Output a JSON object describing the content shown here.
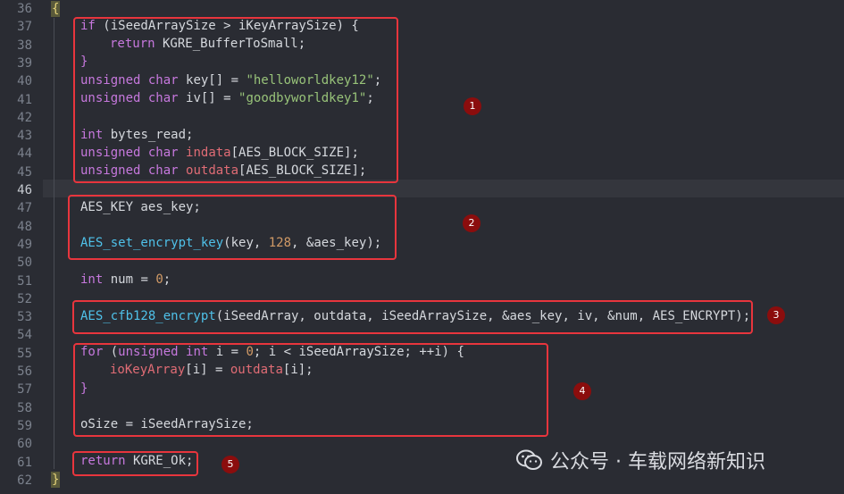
{
  "editor": {
    "line_numbers": [
      "36",
      "37",
      "38",
      "39",
      "40",
      "41",
      "42",
      "43",
      "44",
      "45",
      "46",
      "47",
      "48",
      "49",
      "50",
      "51",
      "52",
      "53",
      "54",
      "55",
      "56",
      "57",
      "58",
      "59",
      "60",
      "61",
      "62"
    ],
    "current_line": "46",
    "open_brace": "{",
    "close_brace": "}"
  },
  "code": {
    "l37": {
      "kw": "if",
      "t1": " (iSeedArraySize > iKeyArraySize) {"
    },
    "l38": {
      "kw": "return",
      "t1": " KGRE_BufferToSmall;"
    },
    "l39": {
      "t1": "}"
    },
    "l40": {
      "ty1": "unsigned",
      "ty2": "char",
      "t1": " key[] = ",
      "str": "\"helloworldkey12\"",
      "t2": ";"
    },
    "l41": {
      "ty1": "unsigned",
      "ty2": "char",
      "t1": " iv[] = ",
      "str": "\"goodbyworldkey1\"",
      "t2": ";"
    },
    "l43": {
      "ty1": "int",
      "t1": " bytes_read;"
    },
    "l44": {
      "ty1": "unsigned",
      "ty2": "char",
      "var": "indata",
      "t1": "[AES_BLOCK_SIZE];"
    },
    "l45": {
      "ty1": "unsigned",
      "ty2": "char",
      "var": "outdata",
      "t1": "[AES_BLOCK_SIZE];"
    },
    "l47": {
      "t1": "AES_KEY aes_key;"
    },
    "l49": {
      "fn": "AES_set_encrypt_key",
      "t1": "(key, ",
      "num": "128",
      "t2": ", &aes_key);"
    },
    "l51": {
      "ty1": "int",
      "t1": " num = ",
      "num": "0",
      "t2": ";"
    },
    "l53": {
      "fn": "AES_cfb128_encrypt",
      "t1": "(iSeedArray, outdata, iSeedArraySize, &aes_key, iv, &num, AES_ENCRYPT);"
    },
    "l55": {
      "kw": "for",
      "t1": " (",
      "ty1": "unsigned",
      "ty2": "int",
      "t2": " i = ",
      "num": "0",
      "t3": "; i < iSeedArraySize; ++i) {"
    },
    "l56": {
      "var1": "ioKeyArray",
      "t1": "[i] = ",
      "var2": "outdata",
      "t2": "[i];"
    },
    "l57": {
      "t1": "}"
    },
    "l59": {
      "t1": "oSize = iSeedArraySize;"
    },
    "l61": {
      "kw": "return",
      "t1": " KGRE_Ok;"
    }
  },
  "annotations": {
    "badges": [
      "1",
      "2",
      "3",
      "4",
      "5"
    ],
    "box_color": "#e8353d",
    "badge_color": "#8b0d0d"
  },
  "watermark": {
    "text": "公众号 · 车载网络新知识",
    "icon": "wechat-icon"
  }
}
